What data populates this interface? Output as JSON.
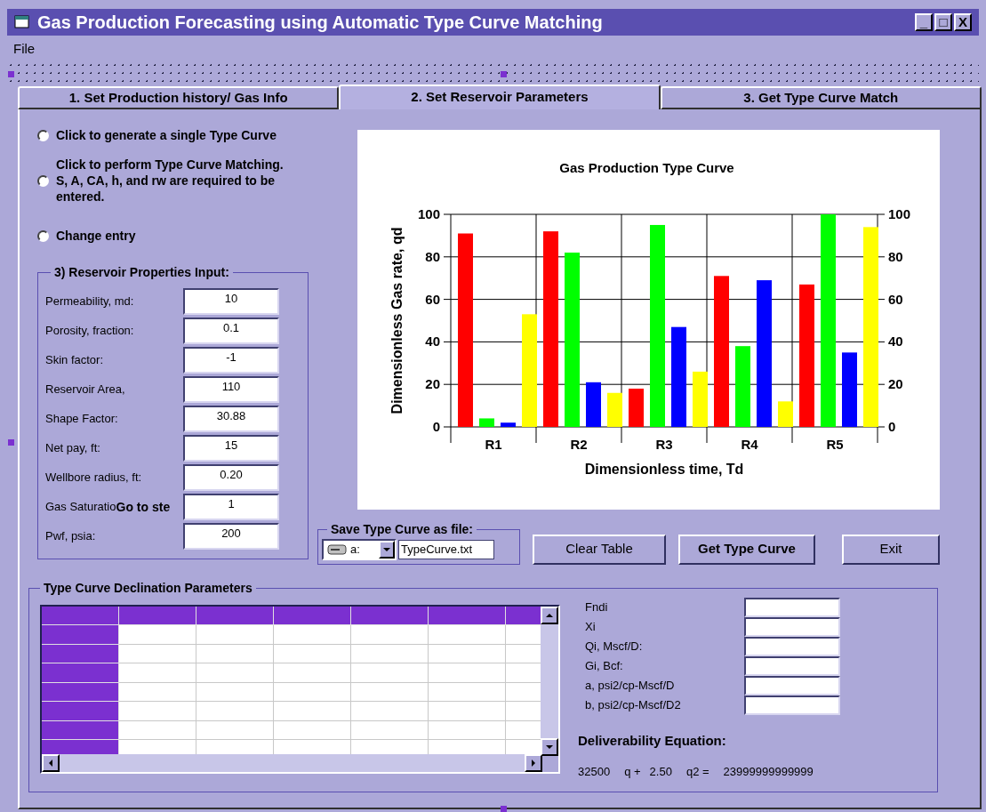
{
  "window": {
    "title": "Gas Production Forecasting using Automatic Type Curve Matching",
    "controls": [
      "_",
      "□",
      "X"
    ]
  },
  "menu": [
    "File"
  ],
  "tabs": [
    {
      "label": "1. Set Production history/ Gas Info",
      "selected": false
    },
    {
      "label": "2.  Set Reservoir Parameters",
      "selected": true
    },
    {
      "label": "3.  Get Type Curve Match",
      "selected": false
    }
  ],
  "options": [
    {
      "label": "Click to generate a single Type Curve",
      "selected": false
    },
    {
      "label": "Click to perform Type Curve Matching. S, A, CA, h, and rw are required to be entered.",
      "selected": false
    },
    {
      "label": "Change entry",
      "selected": false
    }
  ],
  "reservoir": {
    "title": "3)  Reservoir Properties Input:",
    "fields": [
      {
        "label": "Permeability, md:",
        "value": "10"
      },
      {
        "label": "Porosity, fraction:",
        "value": "0.1"
      },
      {
        "label": "Skin factor:",
        "value": "-1"
      },
      {
        "label": "Reservoir Area,",
        "value": "110"
      },
      {
        "label": "Shape Factor:",
        "value": "30.88"
      },
      {
        "label": "Net pay, ft:",
        "value": "15"
      },
      {
        "label": "Wellbore radius, ft:",
        "value": "0.20"
      },
      {
        "label": "Gas Saturatio",
        "value": "1",
        "overlay": "Go to ste"
      },
      {
        "label": "Pwf, psia:",
        "value": "200"
      }
    ]
  },
  "chart": {
    "chart_data": {
      "type": "bar",
      "title": "Gas Production Type Curve",
      "xlabel": "Dimensionless time, Td",
      "ylabel": "Dimensionless Gas rate, qd",
      "categories": [
        "R1",
        "R2",
        "R3",
        "R4",
        "R5"
      ],
      "series": [
        {
          "color": "#ff0000",
          "values": [
            91,
            92,
            18,
            71,
            67
          ]
        },
        {
          "color": "#00ff00",
          "values": [
            4,
            82,
            95,
            38,
            100
          ]
        },
        {
          "color": "#0000ff",
          "values": [
            2,
            21,
            47,
            69,
            35
          ]
        },
        {
          "color": "#ffff00",
          "values": [
            53,
            16,
            26,
            12,
            94
          ]
        }
      ],
      "ylim": [
        0,
        100
      ],
      "yticks": [
        0,
        20,
        40,
        60,
        80,
        100
      ],
      "y2ticks": [
        0,
        20,
        40,
        60,
        80,
        100
      ],
      "y2lim": [
        0,
        100
      ],
      "grid": true
    }
  },
  "save": {
    "title": "Save Type Curve as file:",
    "drive": "a:",
    "filename": "TypeCurve.txt"
  },
  "buttons": [
    {
      "label": "Clear Table",
      "bold": false
    },
    {
      "label": "Get Type Curve",
      "bold": true
    },
    {
      "label": "Exit",
      "bold": false
    }
  ],
  "declination": {
    "title": "Type Curve Declination Parameters",
    "params": [
      {
        "label": "Fndi"
      },
      {
        "label": "Xi"
      },
      {
        "label": "Qi, Mscf/D:"
      },
      {
        "label": "Gi, Bcf:"
      },
      {
        "label": "a, psi2/cp-Mscf/D"
      },
      {
        "label": "b, psi2/cp-Mscf/D2"
      }
    ],
    "deliverability_title": "Deliverability Equation:",
    "equation": [
      "32500",
      "q +",
      "2.50",
      "q2 =",
      "23999999999999"
    ]
  }
}
